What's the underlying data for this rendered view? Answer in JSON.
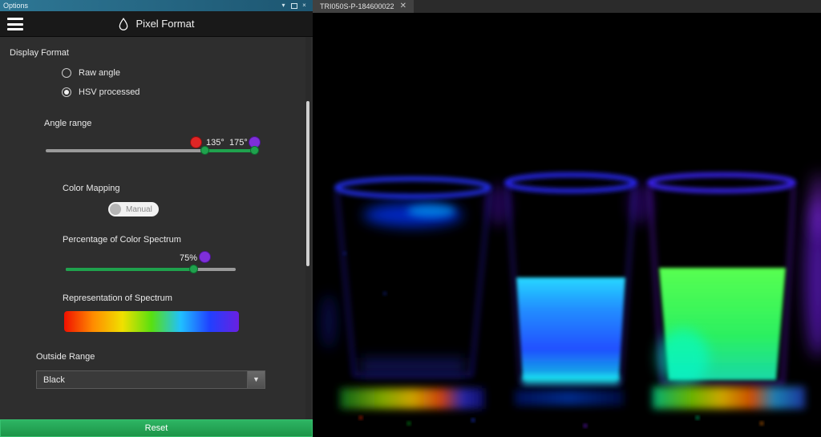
{
  "colors": {
    "accent_green": "#1fa24d",
    "handle_red": "#e02525",
    "handle_purple": "#7e2fd9",
    "titlebar_blue": "#1d5671"
  },
  "window": {
    "title": "Options"
  },
  "header": {
    "title": "Pixel Format"
  },
  "panel": {
    "display_format": {
      "label": "Display Format",
      "options": [
        {
          "label": "Raw angle",
          "selected": false
        },
        {
          "label": "HSV processed",
          "selected": true
        }
      ]
    },
    "angle_range": {
      "label": "Angle range",
      "low_label": "135°",
      "high_label": "175°"
    },
    "color_mapping": {
      "label": "Color Mapping",
      "toggle_label": "Manual",
      "toggle_on": false
    },
    "percentage": {
      "label": "Percentage of Color Spectrum",
      "value_label": "75%",
      "value": 75
    },
    "spectrum": {
      "label": "Representation of Spectrum",
      "gradient": [
        "#f01000",
        "#ff8c00",
        "#f0e000",
        "#58e010",
        "#20c0ff",
        "#2040ff",
        "#6a20e0"
      ]
    },
    "outside_range": {
      "label": "Outside Range",
      "value": "Black"
    },
    "reset_label": "Reset"
  },
  "viewer": {
    "tab_label": "TRI050S-P-184600022"
  }
}
